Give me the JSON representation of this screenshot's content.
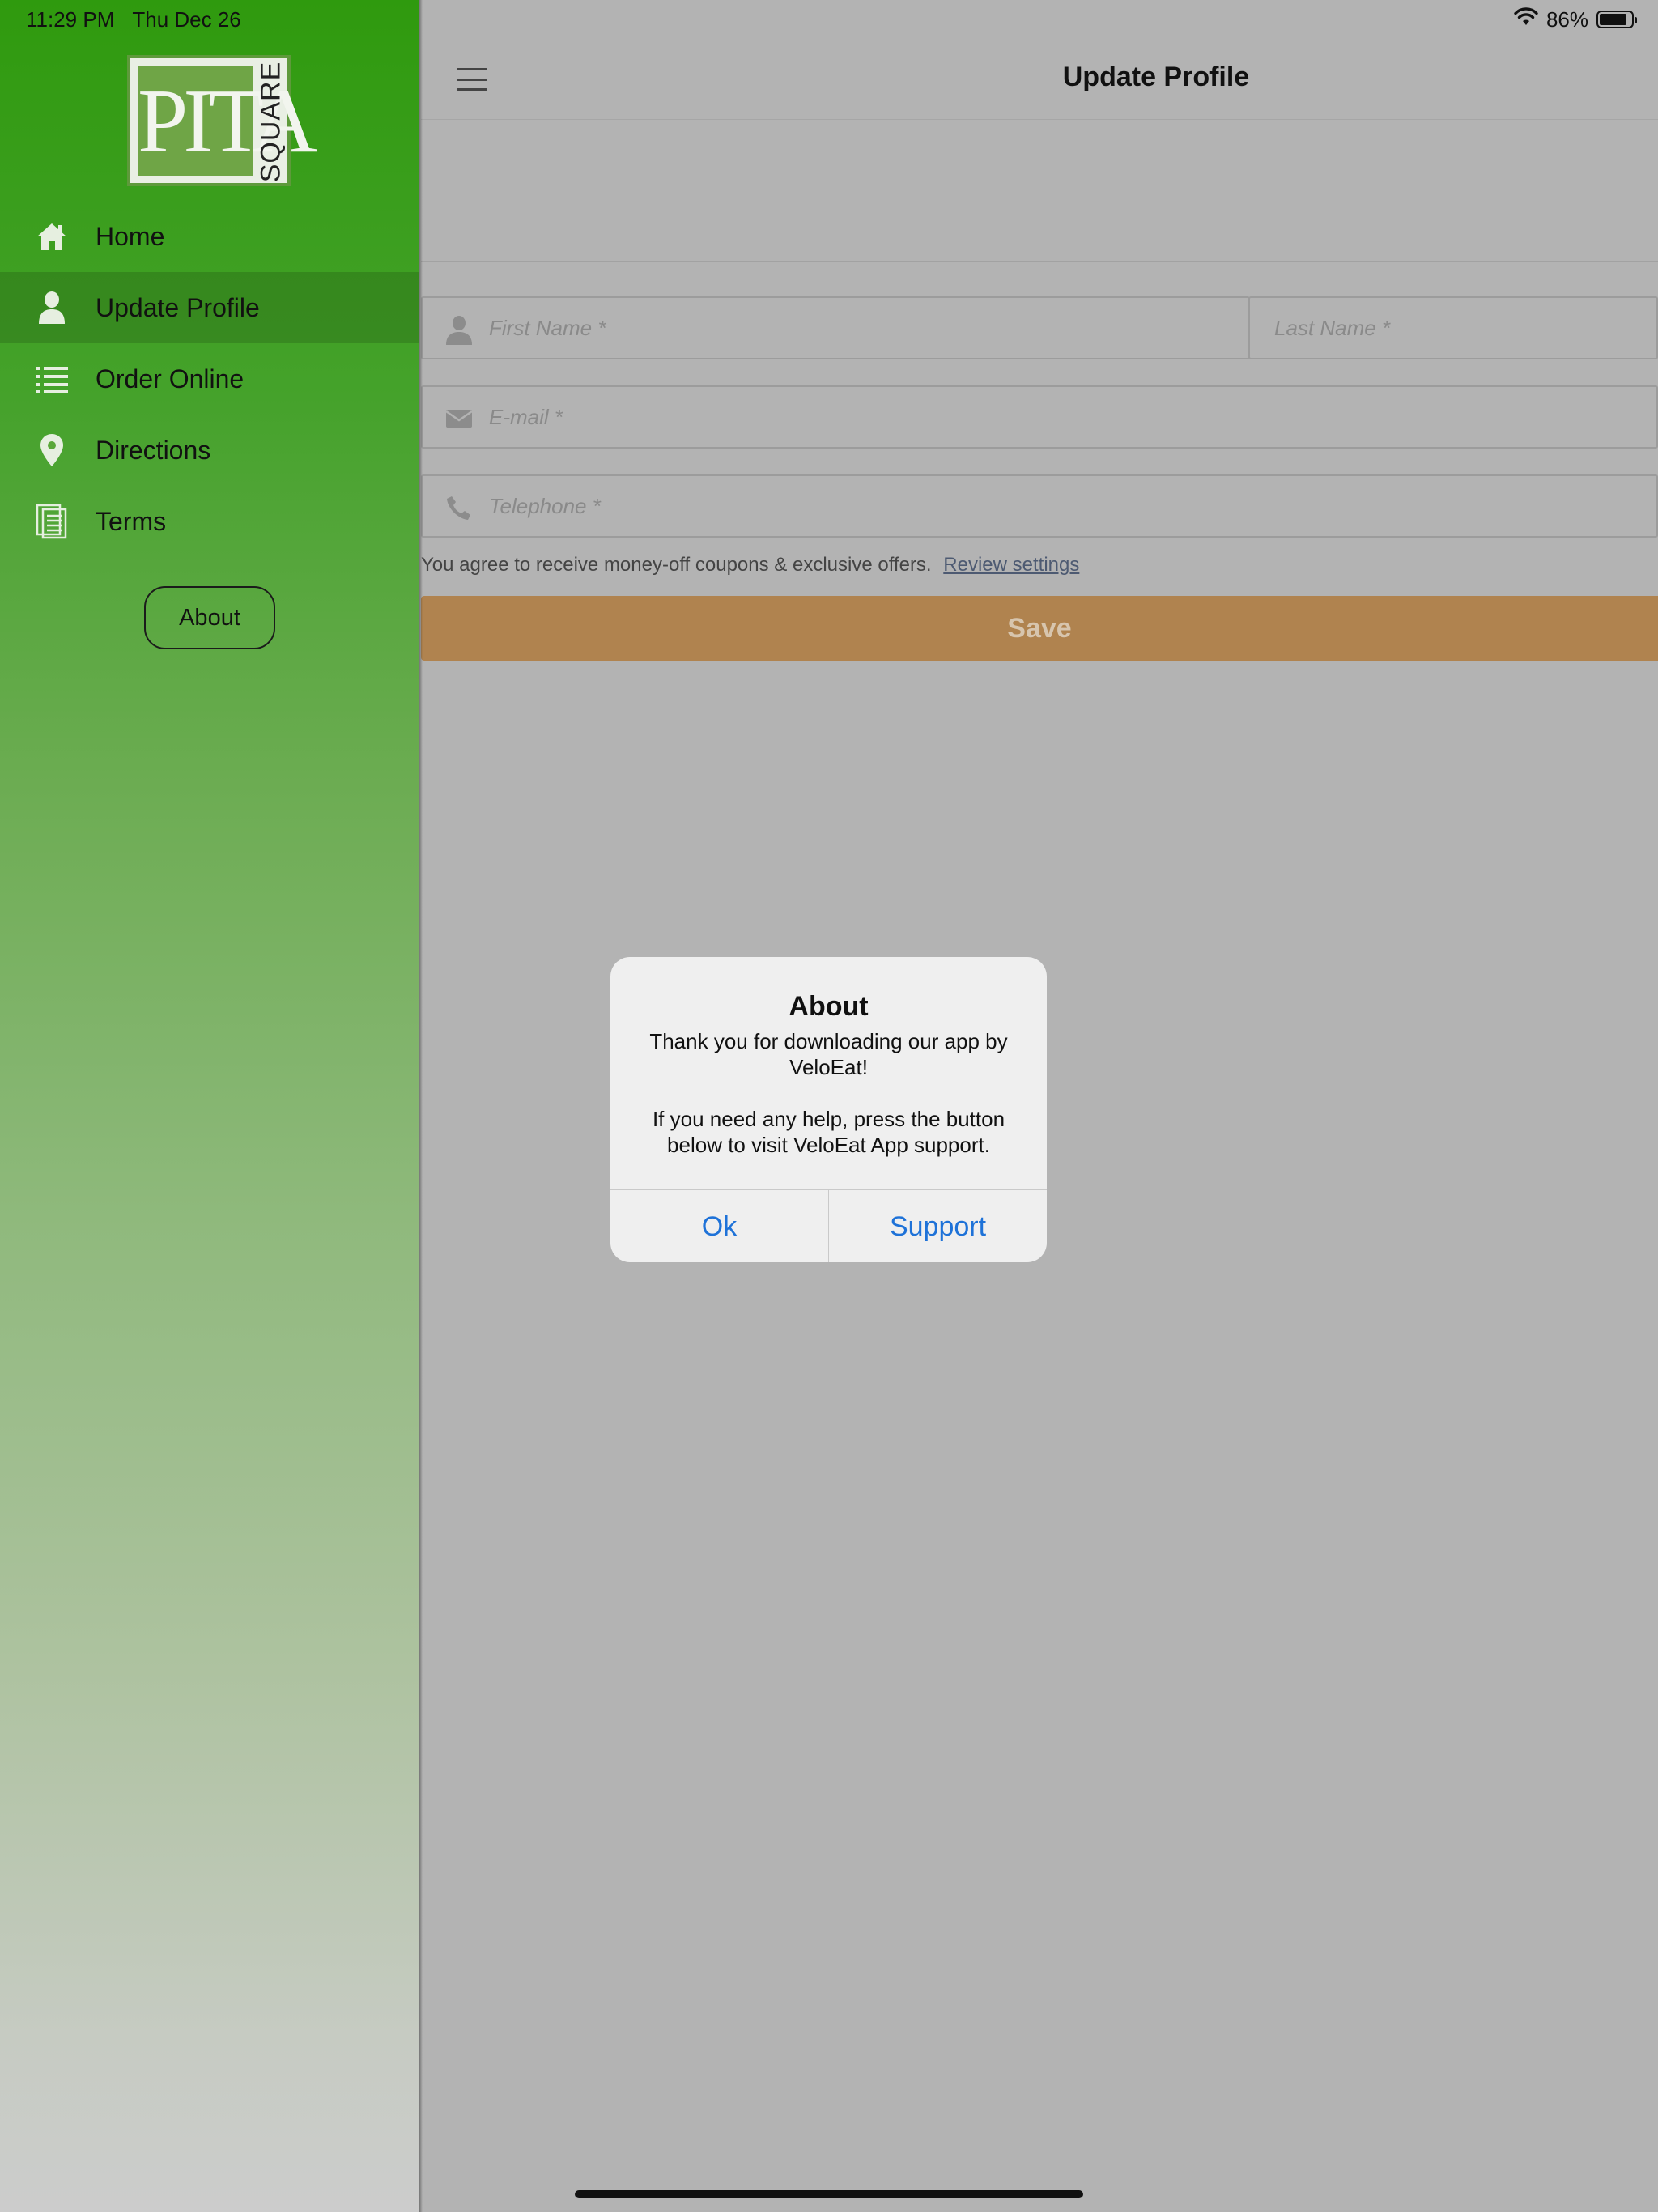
{
  "status_bar": {
    "time": "11:29 PM",
    "date": "Thu Dec 26",
    "battery_percent": "86%",
    "battery_level": 0.86
  },
  "sidebar": {
    "logo": {
      "word": "PITA",
      "side_word": "SQUARE"
    },
    "items": [
      {
        "label": "Home",
        "icon": "home-icon",
        "active": false
      },
      {
        "label": "Update Profile",
        "icon": "user-icon",
        "active": true
      },
      {
        "label": "Order Online",
        "icon": "list-icon",
        "active": false
      },
      {
        "label": "Directions",
        "icon": "map-pin-icon",
        "active": false
      },
      {
        "label": "Terms",
        "icon": "document-icon",
        "active": false
      }
    ],
    "about_label": "About"
  },
  "header": {
    "title": "Update Profile",
    "menu_icon": "hamburger-icon"
  },
  "form": {
    "first_name_placeholder": "First Name *",
    "last_name_placeholder": "Last Name *",
    "email_placeholder": "E-mail *",
    "telephone_placeholder": "Telephone *",
    "consent_text": "You agree to receive money-off coupons & exclusive offers.",
    "review_settings_link": "Review settings",
    "save_label": "Save"
  },
  "alert": {
    "title": "About",
    "message_line1": "Thank you for downloading our app by VeloEat!",
    "message_line2": "If you need any help, press the button below to visit VeloEat App support.",
    "ok_label": "Ok",
    "support_label": "Support"
  },
  "colors": {
    "sidebar_top": "#2f9a0e",
    "save_button": "#b0834f",
    "alert_button_text": "#1e72d8",
    "dim_overlay": "#b3b3b3"
  }
}
